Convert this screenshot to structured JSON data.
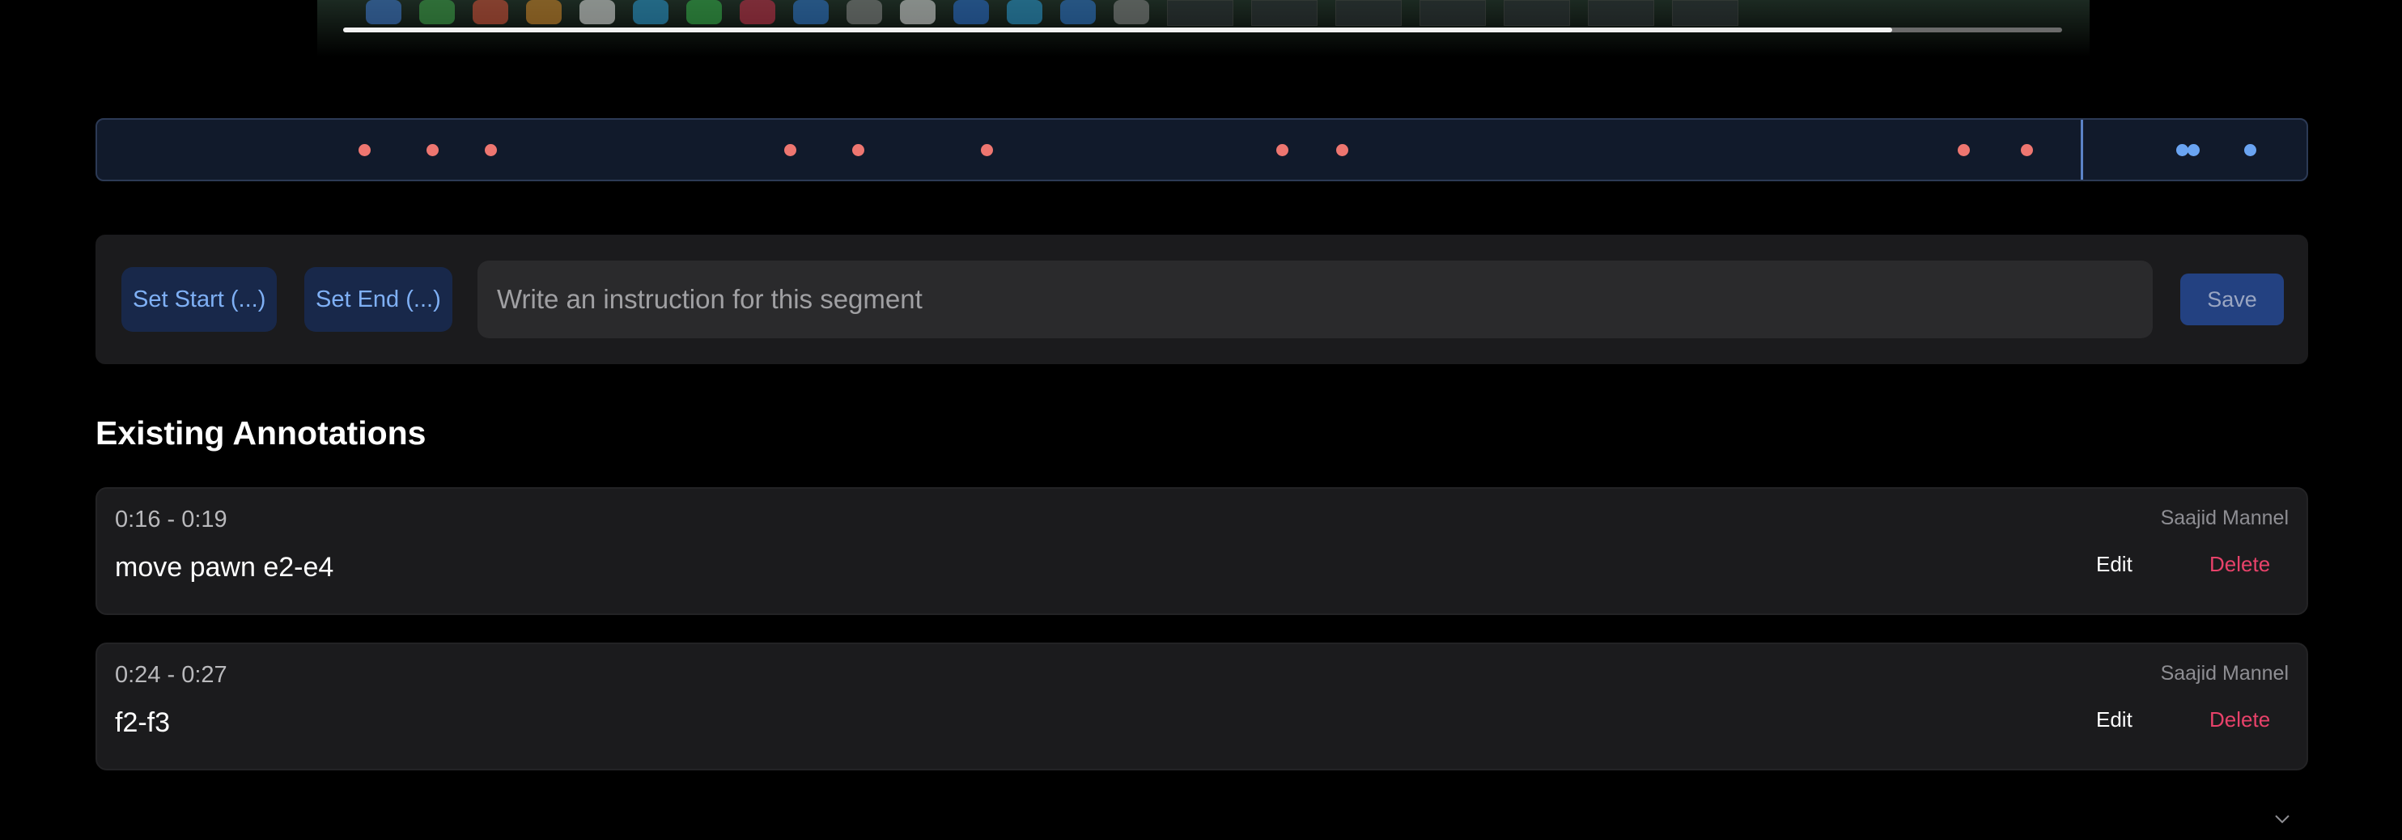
{
  "video": {
    "progress": 0.901
  },
  "timeline": {
    "marker_color_existing": "#ee7670",
    "marker_color_current": "#6aa4f2",
    "playhead_color": "#5b83c7"
  },
  "controls": {
    "set_start_label": "Set Start (...)",
    "set_end_label": "Set End (...)",
    "instruction_placeholder": "Write an instruction for this segment",
    "instruction_value": "",
    "save_label": "Save"
  },
  "annotations_section": {
    "title": "Existing Annotations",
    "items": [
      {
        "range": "0:16 - 0:19",
        "text": "move pawn e2-e4",
        "author": "Saajid Mannel",
        "edit_label": "Edit",
        "delete_label": "Delete"
      },
      {
        "range": "0:24 - 0:27",
        "text": "f2-f3",
        "author": "Saajid Mannel",
        "edit_label": "Edit",
        "delete_label": "Delete"
      }
    ]
  },
  "icons": {
    "scroll_more": "chevron-down-icon"
  },
  "colors": {
    "accent": "#7fb0f5",
    "danger": "#e8426a",
    "save_bg": "#234181"
  }
}
